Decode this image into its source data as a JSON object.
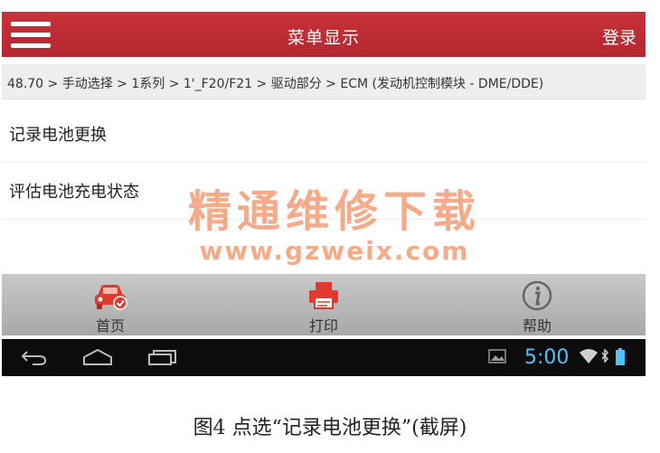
{
  "app_bar": {
    "menu_icon": "hamburger-icon",
    "title": "菜单显示",
    "login": "登录"
  },
  "breadcrumb": "48.70 > 手动选择 > 1系列 > 1'_F20/F21 > 驱动部分 > ECM (发动机控制模块 - DME/DDE)",
  "menu_items": [
    {
      "label": "记录电池更换"
    },
    {
      "label": "评估电池充电状态"
    }
  ],
  "watermark": {
    "title": "精通维修下载",
    "url": "www.gzweix.com"
  },
  "bottom_nav": [
    {
      "label": "首页",
      "icon": "car-check-icon"
    },
    {
      "label": "打印",
      "icon": "printer-icon"
    },
    {
      "label": "帮助",
      "icon": "info-icon"
    }
  ],
  "system_bar": {
    "time": "5:00",
    "icons": [
      "back-icon",
      "home-icon",
      "recent-apps-icon",
      "image-icon",
      "wifi-icon",
      "bluetooth-icon",
      "battery-icon"
    ]
  },
  "caption": "图4   点选“记录电池更换”(截屏)",
  "colors": {
    "app_bar": "#b52730",
    "accent": "#e03030",
    "clock": "#4fc3f7",
    "watermark": "#ec6628"
  }
}
